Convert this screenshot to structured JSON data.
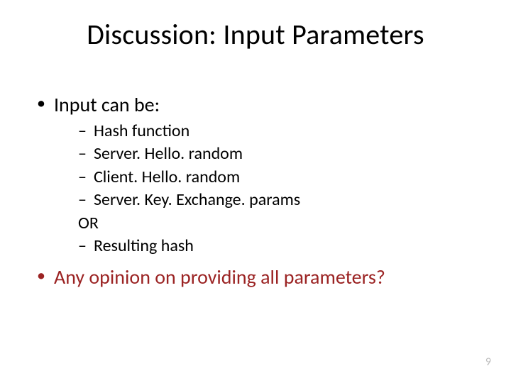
{
  "title": "Discussion: Input Parameters",
  "bullets": {
    "item0": {
      "label": "Input can be:",
      "sub": {
        "s0": "Hash function",
        "s1": "Server. Hello. random",
        "s2": "Client. Hello. random",
        "s3": "Server. Key. Exchange. params",
        "s4_plain": "OR",
        "s5": "Resulting hash"
      }
    },
    "item1": {
      "label": "Any opinion on providing all parameters?"
    }
  },
  "page_number": "9",
  "colors": {
    "accent": "#9b2323"
  }
}
